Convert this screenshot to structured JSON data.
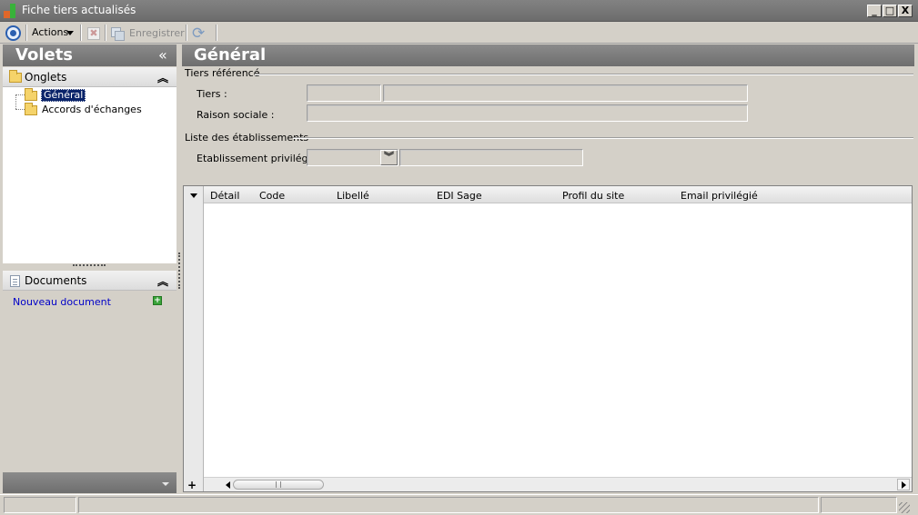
{
  "window": {
    "title": "Fiche tiers actualisés",
    "minimize": "_",
    "maximize": "□",
    "close": "X"
  },
  "toolbar": {
    "actions_label": "Actions",
    "save_label": "Enregistrer",
    "delete_glyph": "✖",
    "refresh_glyph": "⟳"
  },
  "left_pane": {
    "title": "Volets",
    "collapse_glyph": "«",
    "onglets": {
      "label": "Onglets",
      "toggle_glyph": "︽",
      "items": [
        {
          "label": "Général",
          "selected": true
        },
        {
          "label": "Accords d'échanges",
          "selected": false
        }
      ]
    },
    "documents": {
      "label": "Documents",
      "toggle_glyph": "︽",
      "new_document_link": "Nouveau document",
      "add_glyph": "+"
    }
  },
  "main": {
    "title": "Général",
    "tiers_group": {
      "title": "Tiers référencé",
      "tiers_label": "Tiers :",
      "tiers_code": "",
      "tiers_name": "",
      "raison_sociale_label": "Raison sociale :",
      "raison_sociale": ""
    },
    "etablissements_group": {
      "title": "Liste des établissements",
      "etablissement_label": "Etablissement privilégié :",
      "etablissement_value": "",
      "etablissement_detail": "",
      "dropdown_glyph": "︾"
    },
    "grid": {
      "columns": [
        "Détail",
        "Code",
        "Libellé",
        "EDI Sage",
        "Profil du site",
        "Email privilégié"
      ],
      "rows": [],
      "add_glyph": "+"
    }
  },
  "colors": {
    "header_gradient": "#7c7c7c",
    "selection": "#0a246a",
    "link": "#0000c8",
    "background": "#d4d0c8"
  }
}
